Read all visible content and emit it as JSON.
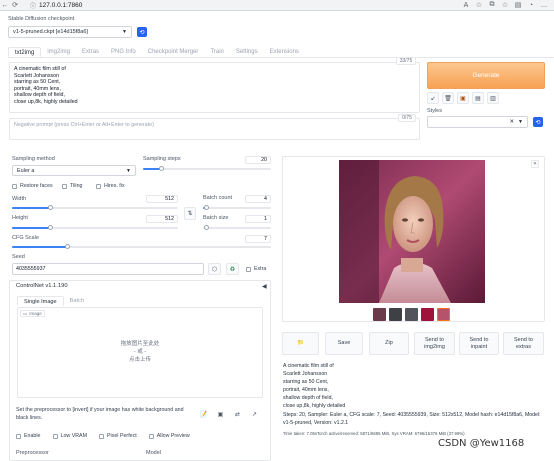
{
  "browser": {
    "back_icon": "back-arrow-icon",
    "url": "127.0.0.1:7860",
    "security_label": "ⓘ"
  },
  "checkpoint": {
    "label": "Stable Diffusion checkpoint",
    "value": "v1-5-pruned.ckpt [e14d15f8a6]"
  },
  "tabs": [
    {
      "label": "txt2img",
      "active": true
    },
    {
      "label": "img2img"
    },
    {
      "label": "Extras"
    },
    {
      "label": "PNG Info"
    },
    {
      "label": "Checkpoint Merger"
    },
    {
      "label": "Train"
    },
    {
      "label": "Settings"
    },
    {
      "label": "Extensions"
    }
  ],
  "prompt": {
    "text": "A cinematic film still of\nScarlett Johansson\nstarring as 50 Cent,\nportrait, 40mm lens,\nshallow depth of field,\nclose up,8k,  highly detailed",
    "counter": "33/75"
  },
  "negative": {
    "placeholder": "Negative prompt (press Ctrl+Enter or Alt+Enter to generate)",
    "counter": "0/75"
  },
  "generate_label": "Generate",
  "styles_label": "Styles",
  "sampling": {
    "method_label": "Sampling method",
    "method_value": "Euler a",
    "steps_label": "Sampling steps",
    "steps_value": "20"
  },
  "options": {
    "restore_faces": "Restore faces",
    "tiling": "Tiling",
    "hires_fix": "Hires. fix"
  },
  "size": {
    "width_label": "Width",
    "width_value": "512",
    "height_label": "Height",
    "height_value": "512",
    "swap_icon": "swap-icon"
  },
  "batch": {
    "count_label": "Batch count",
    "count_value": "4",
    "size_label": "Batch size",
    "size_value": "1"
  },
  "cfg": {
    "label": "CFG Scale",
    "value": "7"
  },
  "seed": {
    "label": "Seed",
    "value": "4035555937",
    "extra_label": "Extra"
  },
  "controlnet": {
    "title": "ControlNet v1.1.190",
    "tab_single": "Single Image",
    "tab_batch": "Batch",
    "image_label": "Image",
    "drop_line1": "拖放图片至此处",
    "drop_line2": "- 或 -",
    "drop_line3": "点击上传",
    "preprocess_hint": "Set the preprocessor to [invert] if your image has white background and black lines.",
    "enable": "Enable",
    "low_vram": "Low VRAM",
    "pixel_perfect": "Pixel Perfect",
    "allow_preview": "Allow Preview",
    "preprocessor_label": "Preprocessor",
    "model_label": "Model"
  },
  "output": {
    "buttons": {
      "folder": "📁",
      "save": "Save",
      "zip": "Zip",
      "to_img2img": "Send to\nimg2img",
      "to_inpaint": "Send to\ninpaint",
      "to_extras": "Send to\nextras"
    },
    "info_prompt": "A cinematic film still of\nScarlett Johansson\nstarring as 50 Cent,\nportrait, 40mm lens,\nshallow depth of field,\nclose up,8k,  highly detailed",
    "info_params": "Steps: 20, Sampler: Euler a, CFG scale: 7, Seed: 4035555939, Size: 512x512, Model hash: e14d15f8a6, Model: v1-5-pruned, Version: v1.2.1",
    "time_taken": "Time taken: 7.05sTorch active/reserved: 5871/6685 MiB, Sys VRAM: 6796/16376 MiB (37.99%)"
  },
  "watermark": "CSDN @Yew1168",
  "colors": {
    "accent_blue": "#2563eb",
    "generate_orange": "#f8a154"
  }
}
